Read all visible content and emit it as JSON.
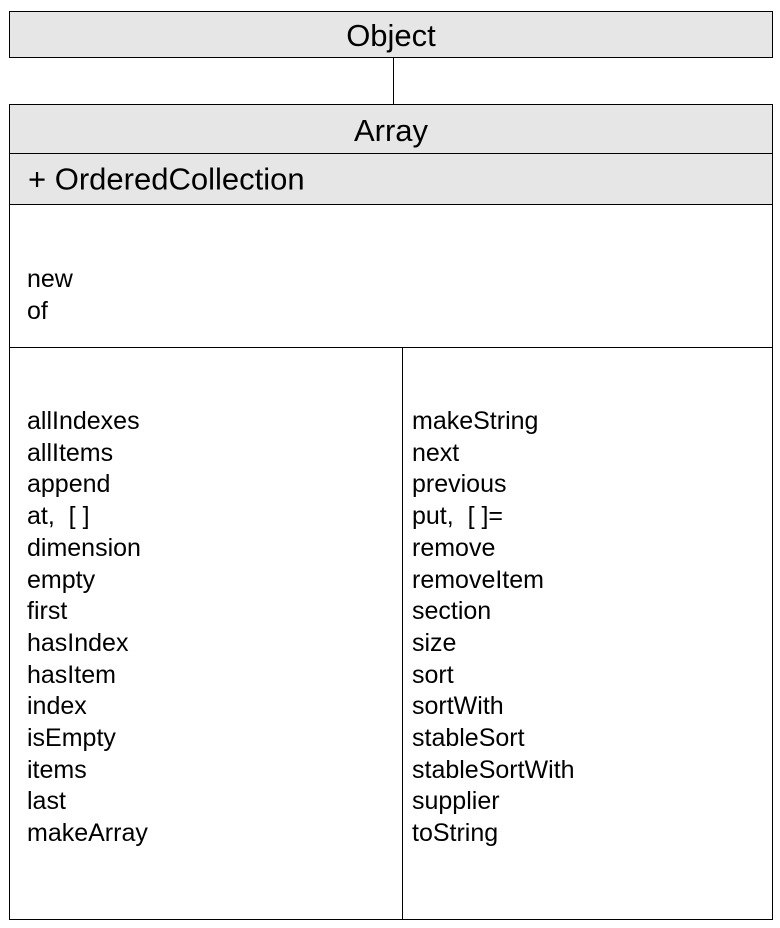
{
  "parent_class": {
    "name": "Object"
  },
  "class": {
    "name": "Array",
    "inherited": "+  OrderedCollection",
    "class_methods": [
      "new",
      "of"
    ],
    "instance_methods_left": [
      "allIndexes",
      "allItems",
      "append",
      "at,  [ ]",
      "dimension",
      "empty",
      "first",
      "hasIndex",
      "hasItem",
      "index",
      "isEmpty",
      "items",
      "last",
      "makeArray"
    ],
    "instance_methods_right": [
      "makeString",
      "next",
      "previous",
      "put,  [ ]=",
      "remove",
      "removeItem",
      "section",
      "size",
      "sort",
      "sortWith",
      "stableSort",
      "stableSortWith",
      "supplier",
      "toString"
    ]
  },
  "colors": {
    "header_fill": "#e6e6e6",
    "border": "#000000",
    "background": "#ffffff"
  }
}
